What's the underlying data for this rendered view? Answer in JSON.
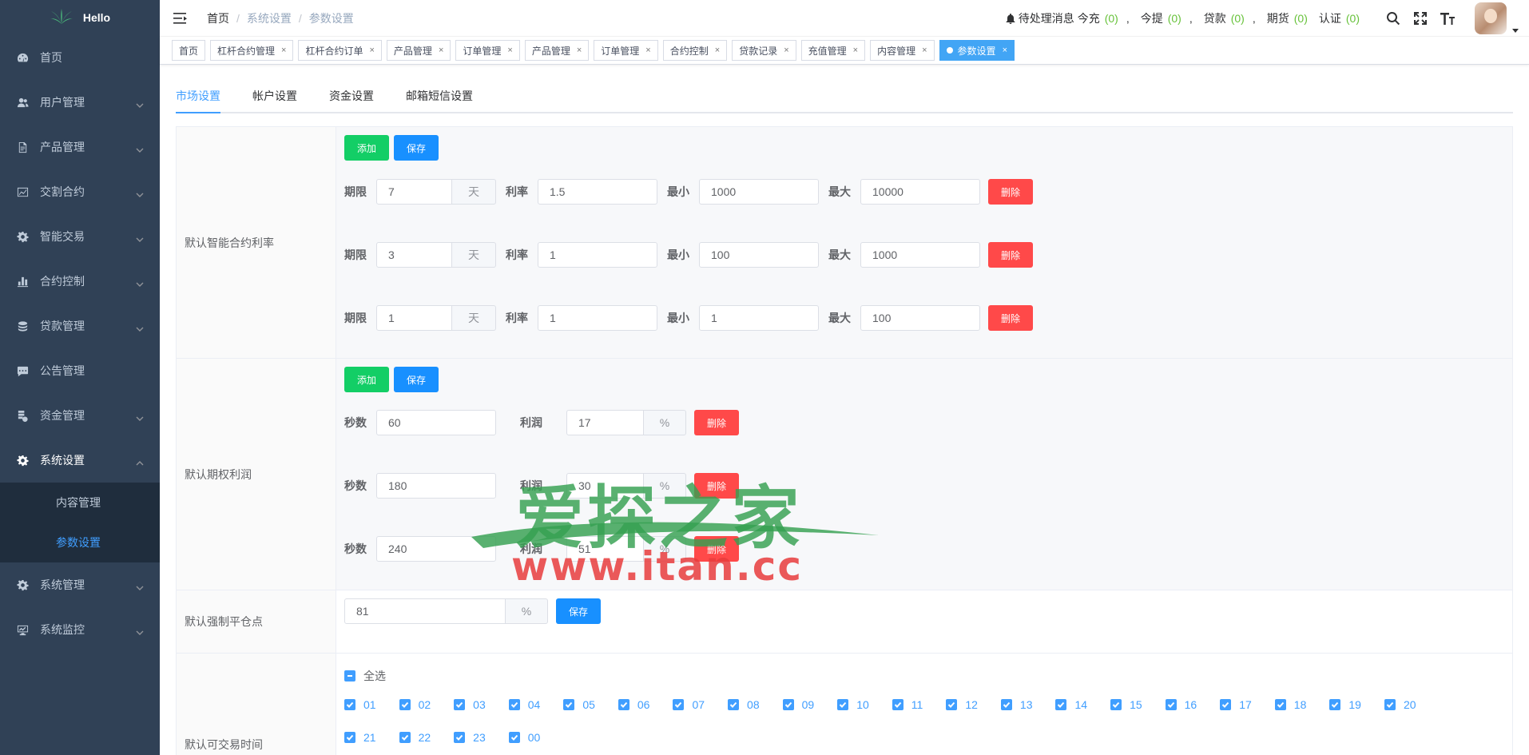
{
  "app": {
    "title": "Hello"
  },
  "sidebar": {
    "items": [
      {
        "label": "首页",
        "icon": "dashboard-icon"
      },
      {
        "label": "用户管理",
        "icon": "user-icon"
      },
      {
        "label": "产品管理",
        "icon": "document-icon"
      },
      {
        "label": "交割合约",
        "icon": "chart-icon"
      },
      {
        "label": "智能交易",
        "icon": "gear-icon"
      },
      {
        "label": "合约控制",
        "icon": "bar-chart-icon"
      },
      {
        "label": "贷款管理",
        "icon": "loan-icon"
      },
      {
        "label": "公告管理",
        "icon": "message-icon"
      },
      {
        "label": "资金管理",
        "icon": "money-icon"
      },
      {
        "label": "系统设置",
        "icon": "settings-icon"
      },
      {
        "label": "系统管理",
        "icon": "settings-icon"
      },
      {
        "label": "系统监控",
        "icon": "monitor-icon"
      }
    ],
    "submenu": [
      {
        "label": "内容管理"
      },
      {
        "label": "参数设置"
      }
    ]
  },
  "navbar": {
    "breadcrumb": [
      "首页",
      "系统设置",
      "参数设置"
    ],
    "breadcrumb_sep": "/",
    "messages": {
      "title": "待处理消息",
      "items": [
        {
          "label": "今充",
          "count": "(0)"
        },
        {
          "label": "今提",
          "count": "(0)"
        },
        {
          "label": "贷款",
          "count": "(0)"
        },
        {
          "label": "期货",
          "count": "(0)"
        },
        {
          "label": "认证",
          "count": "(0)"
        }
      ],
      "sep": ","
    }
  },
  "tags": [
    {
      "label": "首页",
      "closable": false
    },
    {
      "label": "杠杆合约管理",
      "closable": true
    },
    {
      "label": "杠杆合约订单",
      "closable": true
    },
    {
      "label": "产品管理",
      "closable": true
    },
    {
      "label": "订单管理",
      "closable": true
    },
    {
      "label": "产品管理",
      "closable": true
    },
    {
      "label": "订单管理",
      "closable": true
    },
    {
      "label": "合约控制",
      "closable": true
    },
    {
      "label": "贷款记录",
      "closable": true
    },
    {
      "label": "充值管理",
      "closable": true
    },
    {
      "label": "内容管理",
      "closable": true
    },
    {
      "label": "参数设置",
      "closable": true,
      "active": true
    }
  ],
  "tag_close": "×",
  "tabs": [
    "市场设置",
    "帐户设置",
    "资金设置",
    "邮箱短信设置"
  ],
  "buttons": {
    "add": "添加",
    "save": "保存",
    "delete": "删除"
  },
  "contract_rate": {
    "label": "默认智能合约利率",
    "field_labels": {
      "period": "期限",
      "unit": "天",
      "rate": "利率",
      "min": "最小",
      "max": "最大"
    },
    "rows": [
      {
        "period": "7",
        "rate": "1.5",
        "min": "1000",
        "max": "10000"
      },
      {
        "period": "3",
        "rate": "1",
        "min": "100",
        "max": "1000"
      },
      {
        "period": "1",
        "rate": "1",
        "min": "1",
        "max": "100"
      }
    ]
  },
  "option_profit": {
    "label": "默认期权利润",
    "field_labels": {
      "seconds": "秒数",
      "profit": "利润",
      "unit": "%"
    },
    "rows": [
      {
        "seconds": "60",
        "profit": "17"
      },
      {
        "seconds": "180",
        "profit": "30"
      },
      {
        "seconds": "240",
        "profit": "51"
      }
    ]
  },
  "force_close": {
    "label": "默认强制平仓点",
    "value": "81",
    "unit": "%"
  },
  "trade_hours": {
    "label": "默认可交易时间",
    "select_all": "全选",
    "hours": [
      "01",
      "02",
      "03",
      "04",
      "05",
      "06",
      "07",
      "08",
      "09",
      "10",
      "11",
      "12",
      "13",
      "14",
      "15",
      "16",
      "17",
      "18",
      "19",
      "20",
      "21",
      "22",
      "23",
      "00"
    ]
  },
  "watermark": {
    "cn": "爱探之家",
    "en": "www.itan.cc"
  },
  "colors": {
    "sidebar": "#304156",
    "accent": "#409eff",
    "success": "#13ce66",
    "danger": "#ff4949",
    "count": "#67c23a"
  }
}
